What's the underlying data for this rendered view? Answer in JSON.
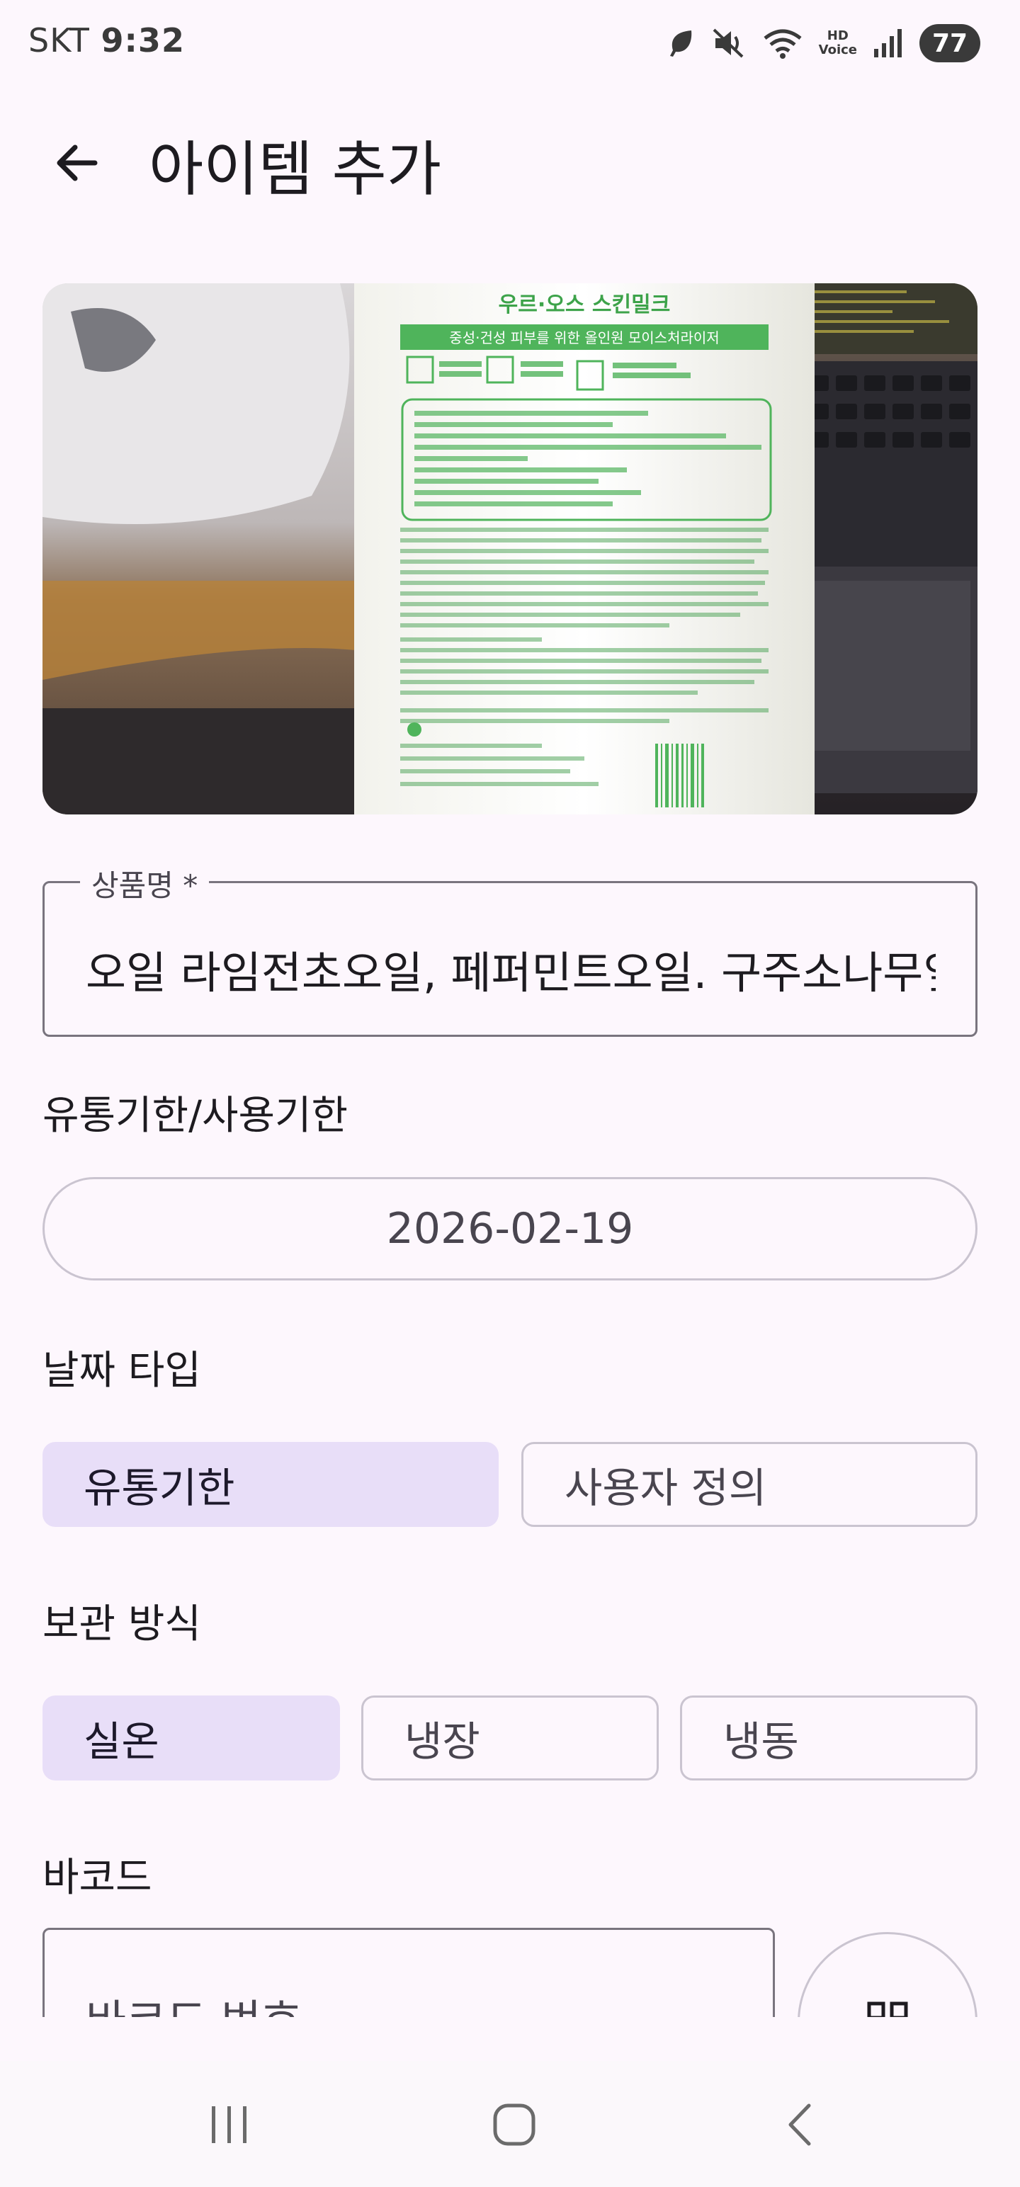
{
  "status_bar": {
    "carrier": "SKT",
    "time": "9:32",
    "battery": "77",
    "hd_top": "HD",
    "hd_bottom": "Voice"
  },
  "app_bar": {
    "title": "아이템 추가",
    "back_icon": "arrow-left-icon"
  },
  "photo": {
    "product_name": "우르·오스 스킨밀크",
    "product_subtitle": "중성·건성 피부를 위한 올인원 모이스처라이저"
  },
  "form": {
    "name_label": "상품명 *",
    "name_value": "오일 라임전초오일, 페퍼민트오일. 구주소나무잎오일",
    "expiry_label": "유통기한/사용기한",
    "expiry_date": "2026-02-19",
    "date_type_label": "날짜 타입",
    "date_type_options": [
      "유통기한",
      "사용자 정의"
    ],
    "date_type_selected": "유통기한",
    "storage_label": "보관 방식",
    "storage_options": [
      "실온",
      "냉장",
      "냉동"
    ],
    "storage_selected": "실온",
    "barcode_label": "바코드",
    "barcode_placeholder": "바코드 번호",
    "scan_icon": "qr-code-scan-icon"
  },
  "colors": {
    "background": "#fdf7fd",
    "chip_selected": "#e8def8",
    "outline": "#79747e",
    "outline_variant": "#cac4d0"
  },
  "nav_bar": {
    "recents_icon": "recents-icon",
    "home_icon": "home-icon",
    "back_icon": "back-icon"
  }
}
